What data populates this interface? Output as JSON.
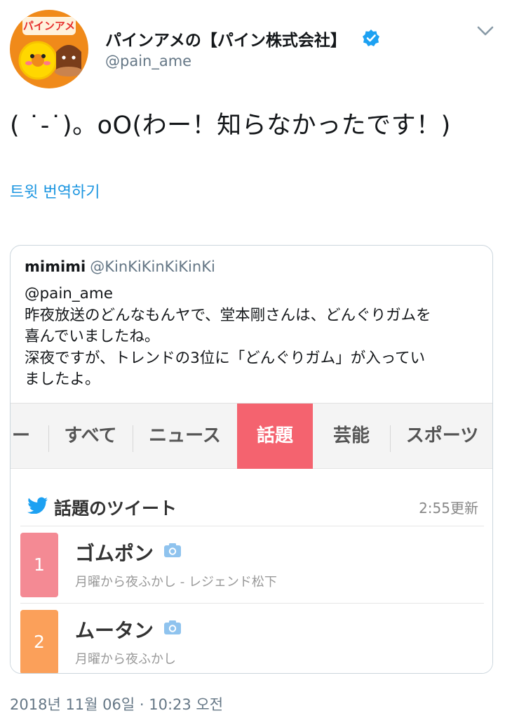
{
  "author": {
    "avatar_brand": "パインアメ",
    "display_name": "パインアメの【パイン株式会社】",
    "handle": "@pain_ame",
    "verified": true
  },
  "tweet": {
    "text": "( ˙-˙)。oO(わー！知らなかったです！)",
    "translate_link": "트윗 번역하기"
  },
  "quoted": {
    "name": "mimimi",
    "handle": "@KinKiKinKiKinKi",
    "lines": [
      "@pain_ame",
      "昨夜放送のどんなもんヤで、堂本剛さんは、どんぐりガムを",
      "喜んでいましたね。",
      "深夜ですが、トレンドの3位に「どんぐりガム」が入ってい",
      "ましたよ。"
    ],
    "screenshot": {
      "tabs": [
        "ー",
        "すべて",
        "ニュース",
        "話題",
        "芸能",
        "スポーツ"
      ],
      "active_tab": "話題",
      "section_title": "話題のツイート",
      "updated": "2:55更新",
      "items": [
        {
          "rank": "1",
          "title": "ゴムポン",
          "subtitle": "月曜から夜ふかし - レジェンド松下",
          "color": "#f48a94"
        },
        {
          "rank": "2",
          "title": "ムータン",
          "subtitle": "月曜から夜ふかし",
          "color": "#fba05a"
        }
      ]
    }
  },
  "timestamp": "2018년 11월 06일 · 10:23 오전",
  "colors": {
    "link": "#1b95e0",
    "verified": "#1da1f2",
    "active_tab": "#f4636f",
    "camera": "#8fc3ee"
  },
  "icons": {
    "verified": "verified-badge-icon",
    "caret": "chevron-down-icon",
    "bird": "twitter-bird-icon",
    "camera": "camera-icon"
  }
}
